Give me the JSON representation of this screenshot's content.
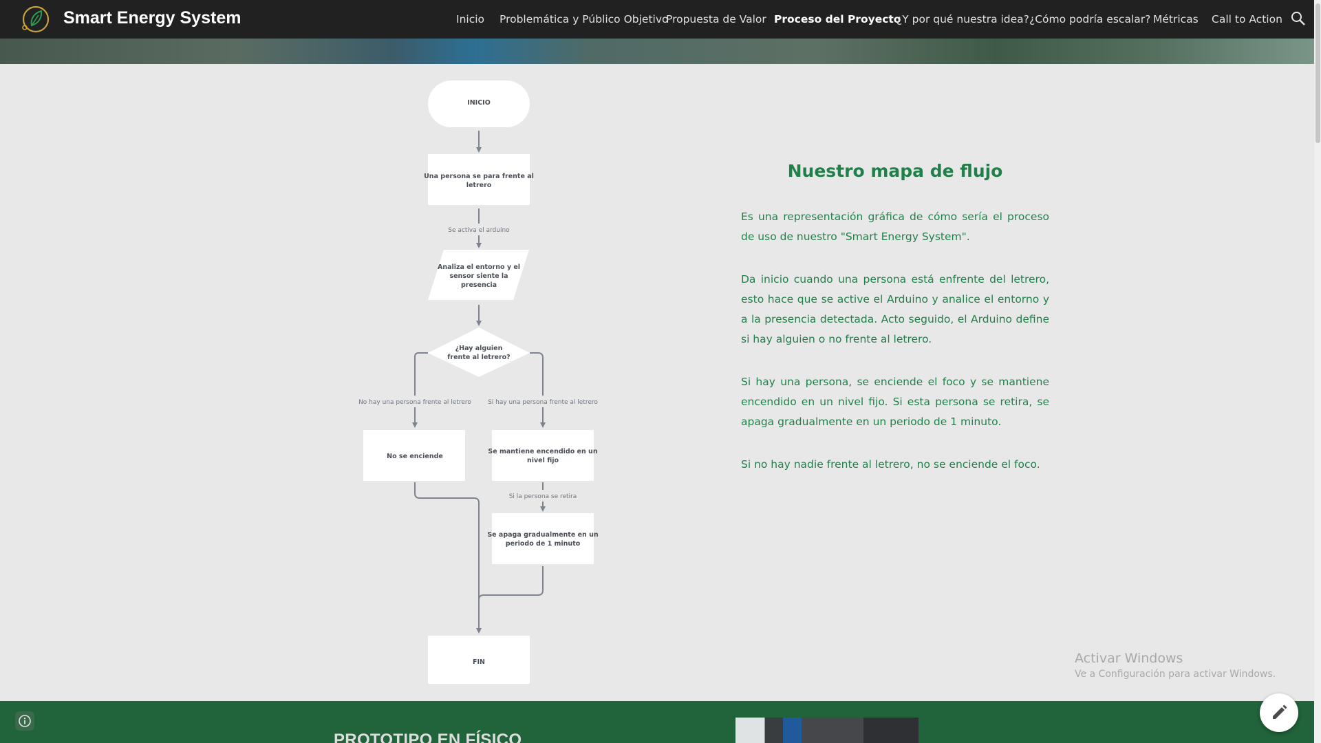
{
  "header": {
    "site_title": "Smart Energy System",
    "logo_icon": "leaf-bulb-logo-icon",
    "search_icon": "search-icon",
    "nav": [
      {
        "label": "Inicio",
        "active": false
      },
      {
        "label": "Problemática y Público Objetivo",
        "active": false
      },
      {
        "label": "Propuesta de Valor",
        "active": false
      },
      {
        "label": "Proceso del Proyecto",
        "active": true
      },
      {
        "label": "¿Y por qué nuestra idea?",
        "active": false
      },
      {
        "label": "¿Cómo podría escalar?",
        "active": false
      },
      {
        "label": "Métricas",
        "active": false
      },
      {
        "label": "Call to Action",
        "active": false
      }
    ]
  },
  "flowchart": {
    "start": "INICIO",
    "step1": [
      "Una persona se para frente al",
      "letrero"
    ],
    "edge1": "Se activa el arduino",
    "step2": [
      "Analiza el entorno y el",
      "sensor siente la",
      "presencia"
    ],
    "decision": [
      "¿Hay alguien",
      "frente al letrero?"
    ],
    "edge_no": "No hay una persona frente al letrero",
    "edge_yes": "Si hay una persona frente al letrero",
    "no_box": "No se enciende",
    "yes_box": [
      "Se mantiene encendido en un",
      "nivel fijo"
    ],
    "edge_retire": "Si la persona se retira",
    "dim_box": [
      "Se apaga gradualmente en un",
      "periodo de 1 minuto"
    ],
    "end": "FIN"
  },
  "content": {
    "heading": "Nuestro mapa de flujo",
    "paragraphs": [
      "Es una representación gráfica de cómo sería el proceso de uso de nuestro \"Smart Energy System\".",
      "Da inicio cuando una persona está enfrente del letrero, esto hace que se active el Arduino y analice el entorno y a la presencia detectada. Acto seguido, el Arduino define si hay alguien o no frente al letrero.",
      "Si  hay una persona, se enciende el foco y se mantiene encendido en un nivel fijo. Si esta persona se retira, se apaga gradualmente en un periodo de 1 minuto.",
      "Si no hay nadie frente al letrero, no se enciende el foco."
    ]
  },
  "watermark": {
    "line1": "Activar Windows",
    "line2": "Ve a Configuración para activar Windows."
  },
  "footer": {
    "section_title": "PROTOTIPO EN FÍSICO",
    "info_icon": "info-icon",
    "edit_icon": "pencil-icon"
  },
  "colors": {
    "header_bg": "#212121",
    "accent_green": "#21804a",
    "footer_green": "#21633a",
    "page_bg": "#e8e8e8"
  }
}
